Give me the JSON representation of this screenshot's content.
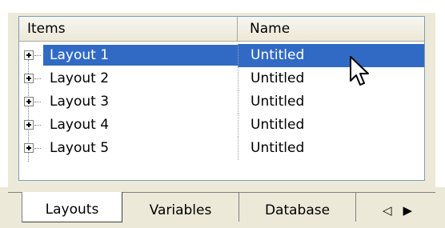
{
  "columns": {
    "items": "Items",
    "name": "Name"
  },
  "rows": [
    {
      "item": "Layout 1",
      "name": "Untitled",
      "selected": true
    },
    {
      "item": "Layout 2",
      "name": "Untitled",
      "selected": false
    },
    {
      "item": "Layout 3",
      "name": "Untitled",
      "selected": false
    },
    {
      "item": "Layout 4",
      "name": "Untitled",
      "selected": false
    },
    {
      "item": "Layout 5",
      "name": "Untitled",
      "selected": false
    }
  ],
  "tabs": [
    "Layouts",
    "Variables",
    "Database"
  ],
  "active_tab": "Layouts",
  "tab_scroll": {
    "left": "◁",
    "right": "▶"
  },
  "colors": {
    "selection": "#316ac5",
    "face": "#ece9d8"
  }
}
